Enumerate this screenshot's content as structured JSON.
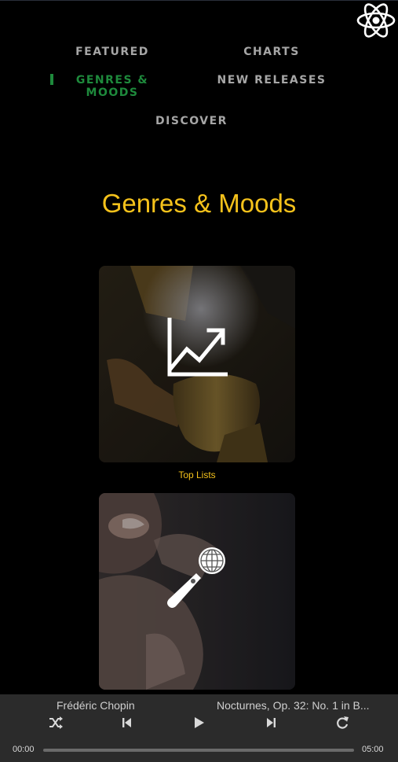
{
  "nav": {
    "featured": "FEATURED",
    "charts": "CHARTS",
    "genres_line1": "GENRES &",
    "genres_line2": "MOODS",
    "new_releases": "NEW RELEASES",
    "discover": "DISCOVER",
    "active": "genres-moods"
  },
  "page": {
    "title": "Genres & Moods"
  },
  "cards": [
    {
      "label": "Top Lists",
      "icon": "trending-chart-icon"
    },
    {
      "label": "",
      "icon": "microphone-icon"
    }
  ],
  "player": {
    "artist": "Frédéric Chopin",
    "track": "Nocturnes, Op. 32: No. 1 in B...",
    "elapsed": "00:00",
    "duration": "05:00",
    "progress": 0,
    "controls": [
      "shuffle-icon",
      "skip-previous-icon",
      "play-icon",
      "skip-next-icon",
      "repeat-icon"
    ]
  },
  "colors": {
    "accent": "#f5c21b",
    "active_nav": "#1e8a3c",
    "nav": "#a6a6a6",
    "player_bg": "#2b2b2b"
  }
}
